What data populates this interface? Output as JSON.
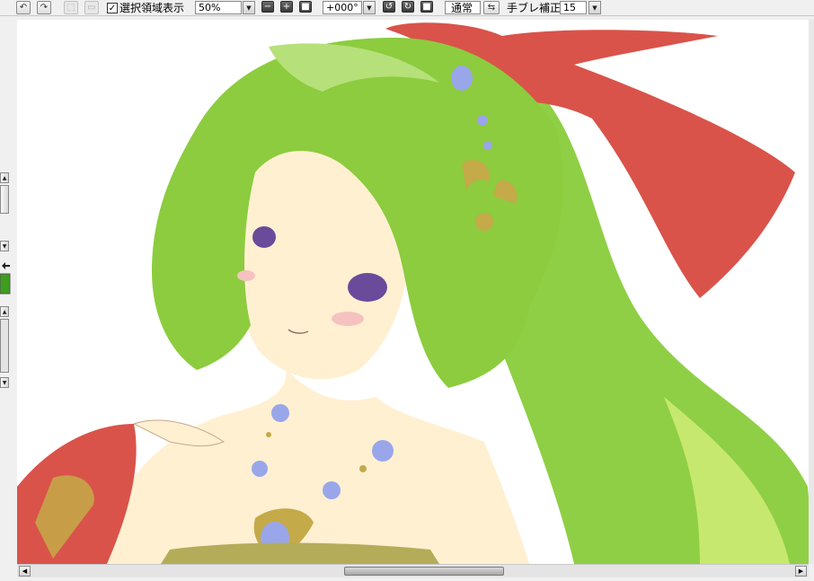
{
  "toolbar": {
    "show_selection_label": "選択領域表示",
    "show_selection_checked": true,
    "check_mark": "✓",
    "zoom_value": "50%",
    "rotation_value": "+000°",
    "blend_mode_value": "通常",
    "stabilizer_label": "手ブレ補正",
    "stabilizer_value": "15",
    "icons": {
      "undo": "↶",
      "redo": "↷",
      "zoom_out": "−",
      "zoom_in": "+",
      "rotate_ccw": "↺",
      "rotate_cw": "↻",
      "flip": "⇆",
      "dropdown": "▼",
      "up": "▲",
      "left": "◀",
      "right": "▶"
    }
  },
  "colors": {
    "chrome": "#f0f0f0",
    "canvas": "#ffffff",
    "hair": "#8ccc3e",
    "ribbon": "#d9534a",
    "skin": "#fff0d2",
    "ornament": "#9aa6ea",
    "gold": "#c4aa48",
    "current_color": "#3f9d1f"
  }
}
